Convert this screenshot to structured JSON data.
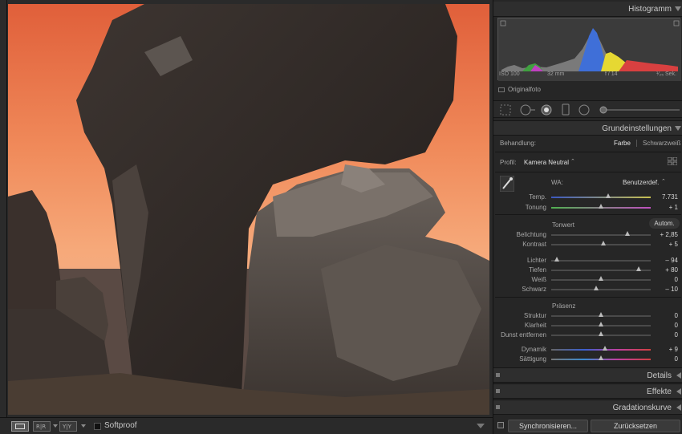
{
  "toolbar": {
    "softproof_label": "Softproof"
  },
  "histogram": {
    "title": "Histogramm",
    "iso": "ISO 100",
    "focal": "32 mm",
    "aperture": "f / 14",
    "shutter": "¹⁄₂₅ Sek.",
    "original_label": "Originalfoto"
  },
  "basic": {
    "title": "Grundeinstellungen",
    "treatment_label": "Behandlung:",
    "color_option": "Farbe",
    "bw_option": "Schwarzweiß",
    "profile_label": "Profil:",
    "profile_value": "Kamera Neutral",
    "wb_label": "WA:",
    "wb_value": "Benutzerdef.",
    "temp_label": "Temp.",
    "temp_value": "7.731",
    "tint_label": "Tonung",
    "tint_value": "+ 1",
    "tone_title": "Tonwert",
    "auto_label": "Autom.",
    "exposure_label": "Belichtung",
    "exposure_value": "+ 2,85",
    "contrast_label": "Kontrast",
    "contrast_value": "+ 5",
    "highlights_label": "Lichter",
    "highlights_value": "– 94",
    "shadows_label": "Tiefen",
    "shadows_value": "+ 80",
    "whites_label": "Weiß",
    "whites_value": "0",
    "blacks_label": "Schwarz",
    "blacks_value": "– 10",
    "presence_title": "Präsenz",
    "texture_label": "Struktur",
    "texture_value": "0",
    "clarity_label": "Klarheit",
    "clarity_value": "0",
    "dehaze_label": "Dunst entfernen",
    "dehaze_value": "0",
    "vibrance_label": "Dynamik",
    "vibrance_value": "+ 9",
    "saturation_label": "Sättigung",
    "saturation_value": "0"
  },
  "panels": {
    "details": "Details",
    "effects": "Effekte",
    "curve": "Gradationskurve"
  },
  "footer": {
    "sync_button": "Synchronisieren...",
    "reset_button": "Zurücksetzen"
  }
}
